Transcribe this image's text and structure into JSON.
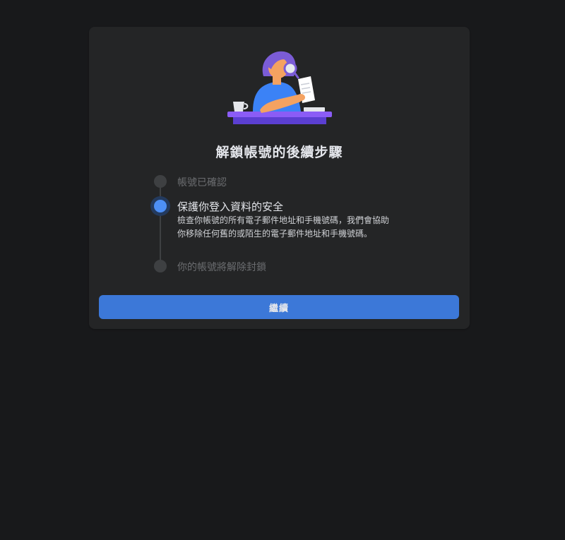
{
  "card": {
    "title": "解鎖帳號的後續步驟"
  },
  "steps": [
    {
      "label": "帳號已確認",
      "state": "done"
    },
    {
      "label": "保護你登入資料的安全",
      "state": "current",
      "description": "檢查你帳號的所有電子郵件地址和手機號碼，我們會協助你移除任何舊的或陌生的電子郵件地址和手機號碼。"
    },
    {
      "label": "你的帳號將解除封鎖",
      "state": "pending"
    }
  ],
  "actions": {
    "continue_label": "繼續"
  },
  "colors": {
    "background": "#18191b",
    "card": "#242526",
    "accent": "#3c78d8",
    "active_dot": "#4d8ff5",
    "inactive": "#3e4042"
  },
  "illustration": {
    "icon": "person-reading-document-illustration"
  }
}
